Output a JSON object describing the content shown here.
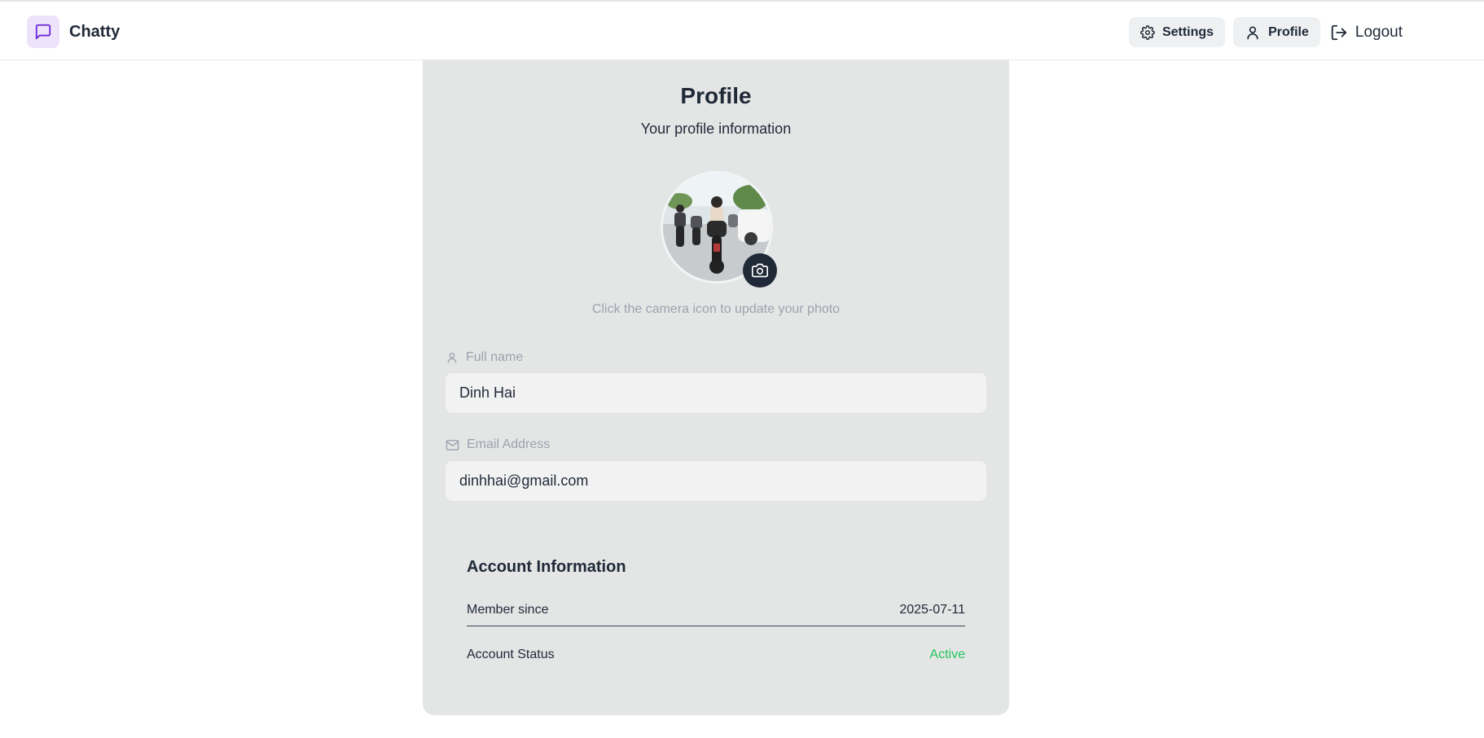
{
  "app": {
    "name": "Chatty",
    "brand_color": "#6d28d9"
  },
  "nav": {
    "settings_label": "Settings",
    "profile_label": "Profile",
    "logout_label": "Logout"
  },
  "profile": {
    "title": "Profile",
    "subtitle": "Your profile information",
    "avatar_hint": "Click the camera icon to update your photo",
    "full_name_label": "Full name",
    "full_name_value": "Dinh Hai",
    "email_label": "Email Address",
    "email_value": "dinhhai@gmail.com"
  },
  "account": {
    "title": "Account Information",
    "member_since_label": "Member since",
    "member_since_value": "2025-07-11",
    "status_label": "Account Status",
    "status_value": "Active",
    "status_color": "#22c55e"
  },
  "icons": {
    "brand": "message-square-icon",
    "settings": "gear-icon",
    "profile": "user-icon",
    "logout": "logout-icon",
    "camera": "camera-icon",
    "name_field": "user-icon",
    "email_field": "mail-icon"
  }
}
